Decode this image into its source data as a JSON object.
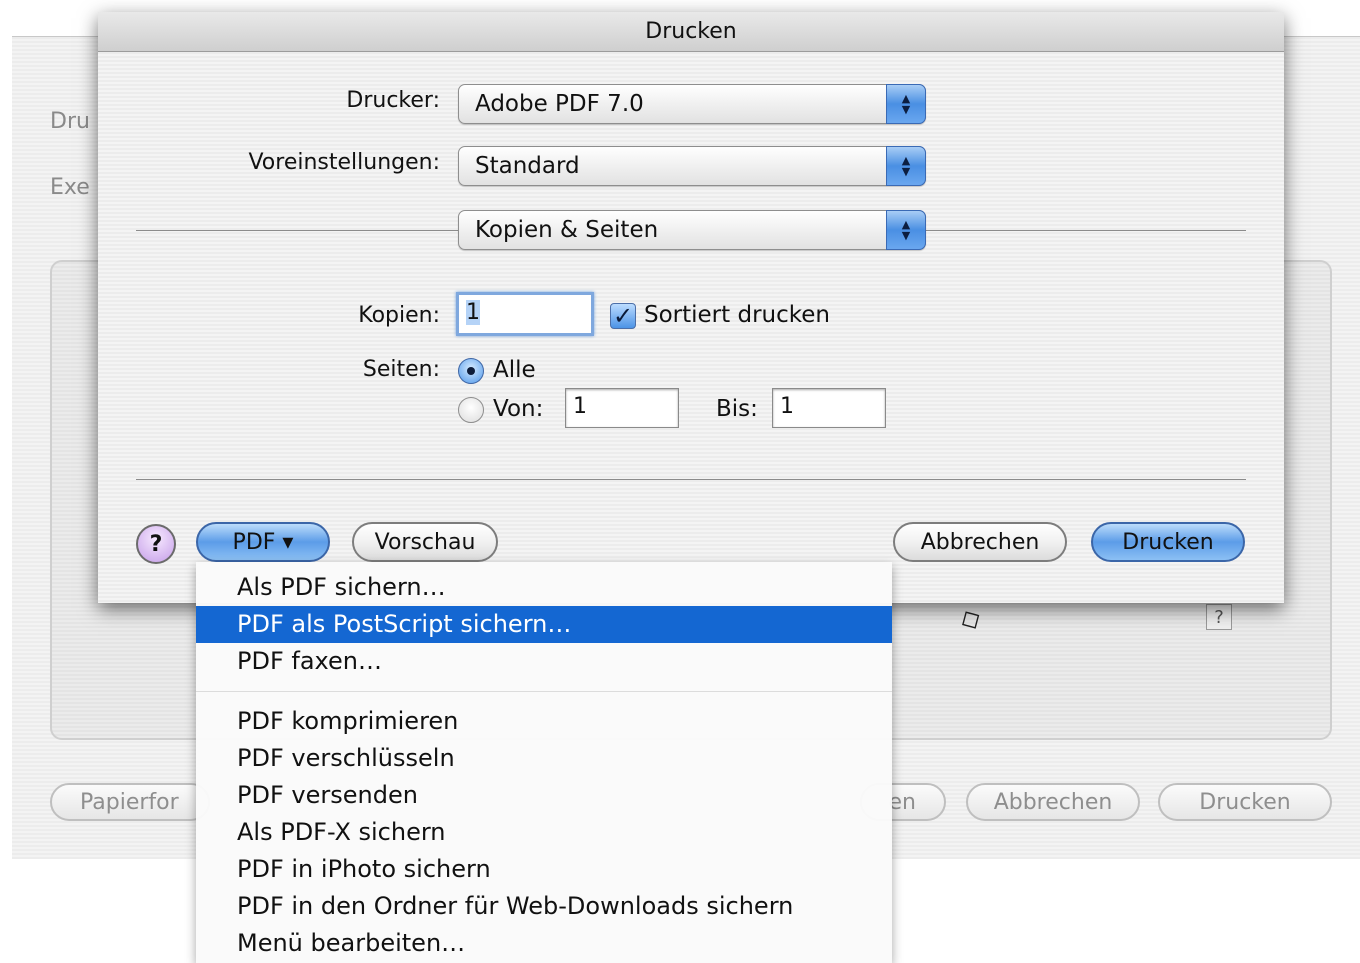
{
  "background_window": {
    "label_1": "Dru",
    "label_2": "Exe",
    "papierformat_button": "Papierfor",
    "partial_button": "en",
    "cancel_button": "Abbrechen",
    "print_button": "Drucken",
    "help_box": "?"
  },
  "sheet": {
    "title": "Drucken",
    "printer_label": "Drucker:",
    "printer_value": "Adobe PDF 7.0",
    "presets_label": "Voreinstellungen:",
    "presets_value": "Standard",
    "pane_value": "Kopien & Seiten",
    "copies_label": "Kopien:",
    "copies_value": "1",
    "collate_label": "Sortiert drucken",
    "collate_checked": true,
    "pages_label": "Seiten:",
    "pages_all_label": "Alle",
    "pages_from_label": "Von:",
    "pages_from_value": "1",
    "pages_to_label": "Bis:",
    "pages_to_value": "1",
    "help_label": "?",
    "pdf_button": "PDF ▾",
    "preview_button": "Vorschau",
    "cancel_button": "Abbrechen",
    "print_button": "Drucken"
  },
  "pdf_menu": {
    "items": [
      "Als PDF sichern…",
      "PDF als PostScript sichern…",
      "PDF faxen…",
      "PDF komprimieren",
      "PDF verschlüsseln",
      "PDF versenden",
      "Als PDF-X sichern",
      "PDF in iPhoto sichern",
      "PDF in den Ordner für Web-Downloads sichern",
      "Menü bearbeiten…"
    ],
    "selected_index": 1
  },
  "colors": {
    "selection": "#1467d2",
    "aqua_blue": "#5c9ce8"
  }
}
